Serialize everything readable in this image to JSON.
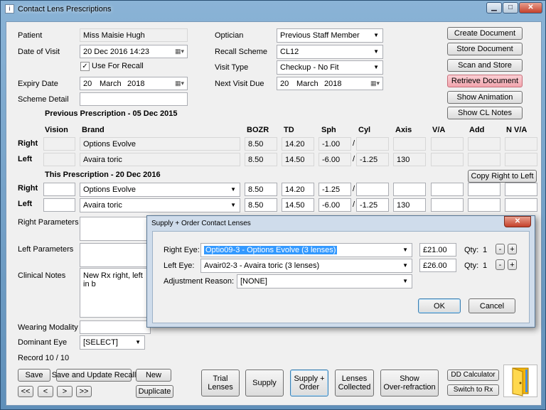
{
  "window": {
    "title": "Contact Lens Prescriptions",
    "icon": "document-icon"
  },
  "patient": {
    "patient_label": "Patient",
    "patient_value": "Miss Maisie Hugh",
    "visit_label": "Date of Visit",
    "visit_value": "20 Dec 2016 14:23",
    "recall_check_label": "Use For Recall",
    "recall_checked": "✓",
    "expiry_label": "Expiry Date",
    "expiry_day": "20",
    "expiry_month": "March",
    "expiry_year": "2018",
    "scheme_detail_label": "Scheme Detail",
    "scheme_detail_value": ""
  },
  "optician": {
    "optician_label": "Optician",
    "optician_value": "Previous Staff Member",
    "recall_scheme_label": "Recall Scheme",
    "recall_scheme_value": "CL12",
    "visit_type_label": "Visit Type",
    "visit_type_value": "Checkup - No Fit",
    "next_visit_label": "Next Visit Due",
    "next_day": "20",
    "next_month": "March",
    "next_year": "2018"
  },
  "actions": {
    "create": "Create Document",
    "store": "Store Document",
    "scan": "Scan and Store",
    "retrieve": "Retrieve Document",
    "animation": "Show Animation",
    "cl_notes": "Show CL Notes"
  },
  "previous": {
    "heading": "Previous Prescription - 05 Dec 2015",
    "headers": [
      "Vision",
      "Brand",
      "BOZR",
      "TD",
      "Sph",
      "Cyl",
      "Axis",
      "V/A",
      "Add",
      "N V/A"
    ],
    "right_label": "Right",
    "left_label": "Left",
    "right": {
      "vision": "",
      "brand": "Options Evolve",
      "bozr": "8.50",
      "td": "14.20",
      "sph": "-1.00",
      "slash": "/",
      "cyl": "",
      "axis": "",
      "va": "",
      "add": "",
      "nva": ""
    },
    "left": {
      "vision": "",
      "brand": "Avaira toric",
      "bozr": "8.50",
      "td": "14.50",
      "sph": "-6.00",
      "slash": "/",
      "cyl": "-1.25",
      "axis": "130",
      "va": "",
      "add": "",
      "nva": ""
    }
  },
  "current": {
    "heading": "This Prescription - 20 Dec 2016",
    "copy_button": "Copy Right to Left",
    "right_label": "Right",
    "left_label": "Left",
    "right": {
      "vision": "",
      "brand": "Options Evolve",
      "bozr": "8.50",
      "td": "14.20",
      "sph": "-1.25",
      "slash": "/",
      "cyl": "",
      "axis": "",
      "va": "",
      "add": "",
      "nva": ""
    },
    "left": {
      "vision": "",
      "brand": "Avaira toric",
      "bozr": "8.50",
      "td": "14.50",
      "sph": "-6.00",
      "slash": "/",
      "cyl": "-1.25",
      "axis": "130",
      "va": "",
      "add": "",
      "nva": ""
    }
  },
  "notes": {
    "right_params_label": "Right Parameters",
    "left_params_label": "Left Parameters",
    "clinical_label": "Clinical Notes",
    "clinical_value": "New Rx right, left in b",
    "wearing_label": "Wearing Modality",
    "dominant_label": "Dominant Eye",
    "dominant_value": "[SELECT]",
    "record": "Record 10 / 10"
  },
  "bottom": {
    "save": "Save",
    "save_recall": "Save and Update Recall",
    "new": "New",
    "duplicate": "Duplicate",
    "first": "<<",
    "prev": "<",
    "next": ">",
    "last": ">>",
    "trial": "Trial\nLenses",
    "supply": "Supply",
    "supply_order": "Supply +\nOrder",
    "collected": "Lenses\nCollected",
    "overref": "Show\nOver-refraction",
    "dd_calc": "DD Calculator",
    "switch_rx": "Switch to Rx"
  },
  "dialog": {
    "title": "Supply + Order Contact Lenses",
    "right_label": "Right Eye:",
    "right_value": "Optio09-3 - Options Evolve (3 lenses)",
    "right_price": "£21.00",
    "left_label": "Left Eye:",
    "left_value": "Avair02-3 - Avaira toric (3 lenses)",
    "left_price": "£26.00",
    "qty_label": "Qty:",
    "right_qty": "1",
    "left_qty": "1",
    "minus": "-",
    "plus": "+",
    "adjust_label": "Adjustment Reason:",
    "adjust_value": "[NONE]",
    "ok": "OK",
    "cancel": "Cancel"
  },
  "colors": {
    "retrieve_button": "#f1a4ad",
    "selection": "#3399ff",
    "title_gradient": "#8ab3d6"
  }
}
